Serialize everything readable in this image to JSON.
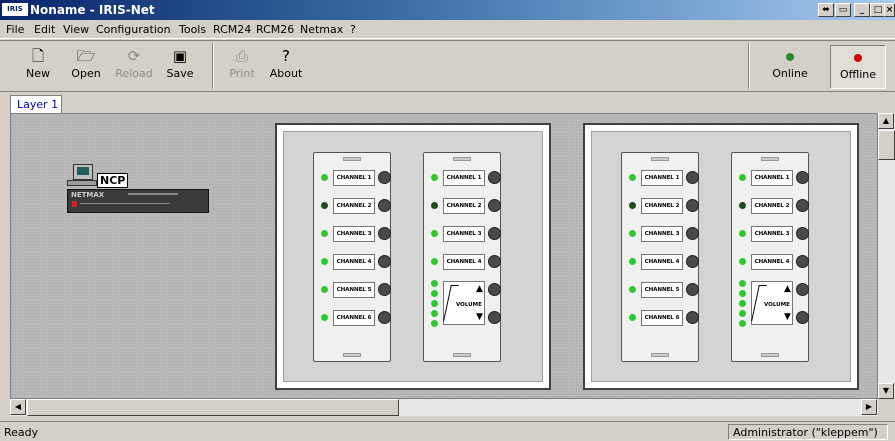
{
  "window": {
    "title": "Noname - IRIS-Net",
    "logo_text": "IRIS",
    "controls": [
      "⬌",
      "▭",
      "_",
      "□",
      "×"
    ]
  },
  "menu": [
    "File",
    "Edit",
    "View",
    "Configuration",
    "Tools",
    "RCM24",
    "RCM26",
    "Netmax",
    "?"
  ],
  "toolbar": {
    "new": "New",
    "open": "Open",
    "reload": "Reload",
    "save": "Save",
    "print": "Print",
    "about": "About",
    "online": "Online",
    "offline": "Offline",
    "online_color": "#2a8a2a",
    "offline_color": "#d00000"
  },
  "tabs": [
    "Layer 1"
  ],
  "device": {
    "ncp_label": "NCP",
    "rack_label": "NETMAX"
  },
  "panels": {
    "channel_labels": [
      "CHANNEL 1",
      "CHANNEL 2",
      "CHANNEL 3",
      "CHANNEL 4",
      "CHANNEL 5",
      "CHANNEL 6"
    ],
    "volume_label": "VOLUME"
  },
  "status": {
    "ready": "Ready",
    "user": "Administrator (\"kleppem\")"
  }
}
